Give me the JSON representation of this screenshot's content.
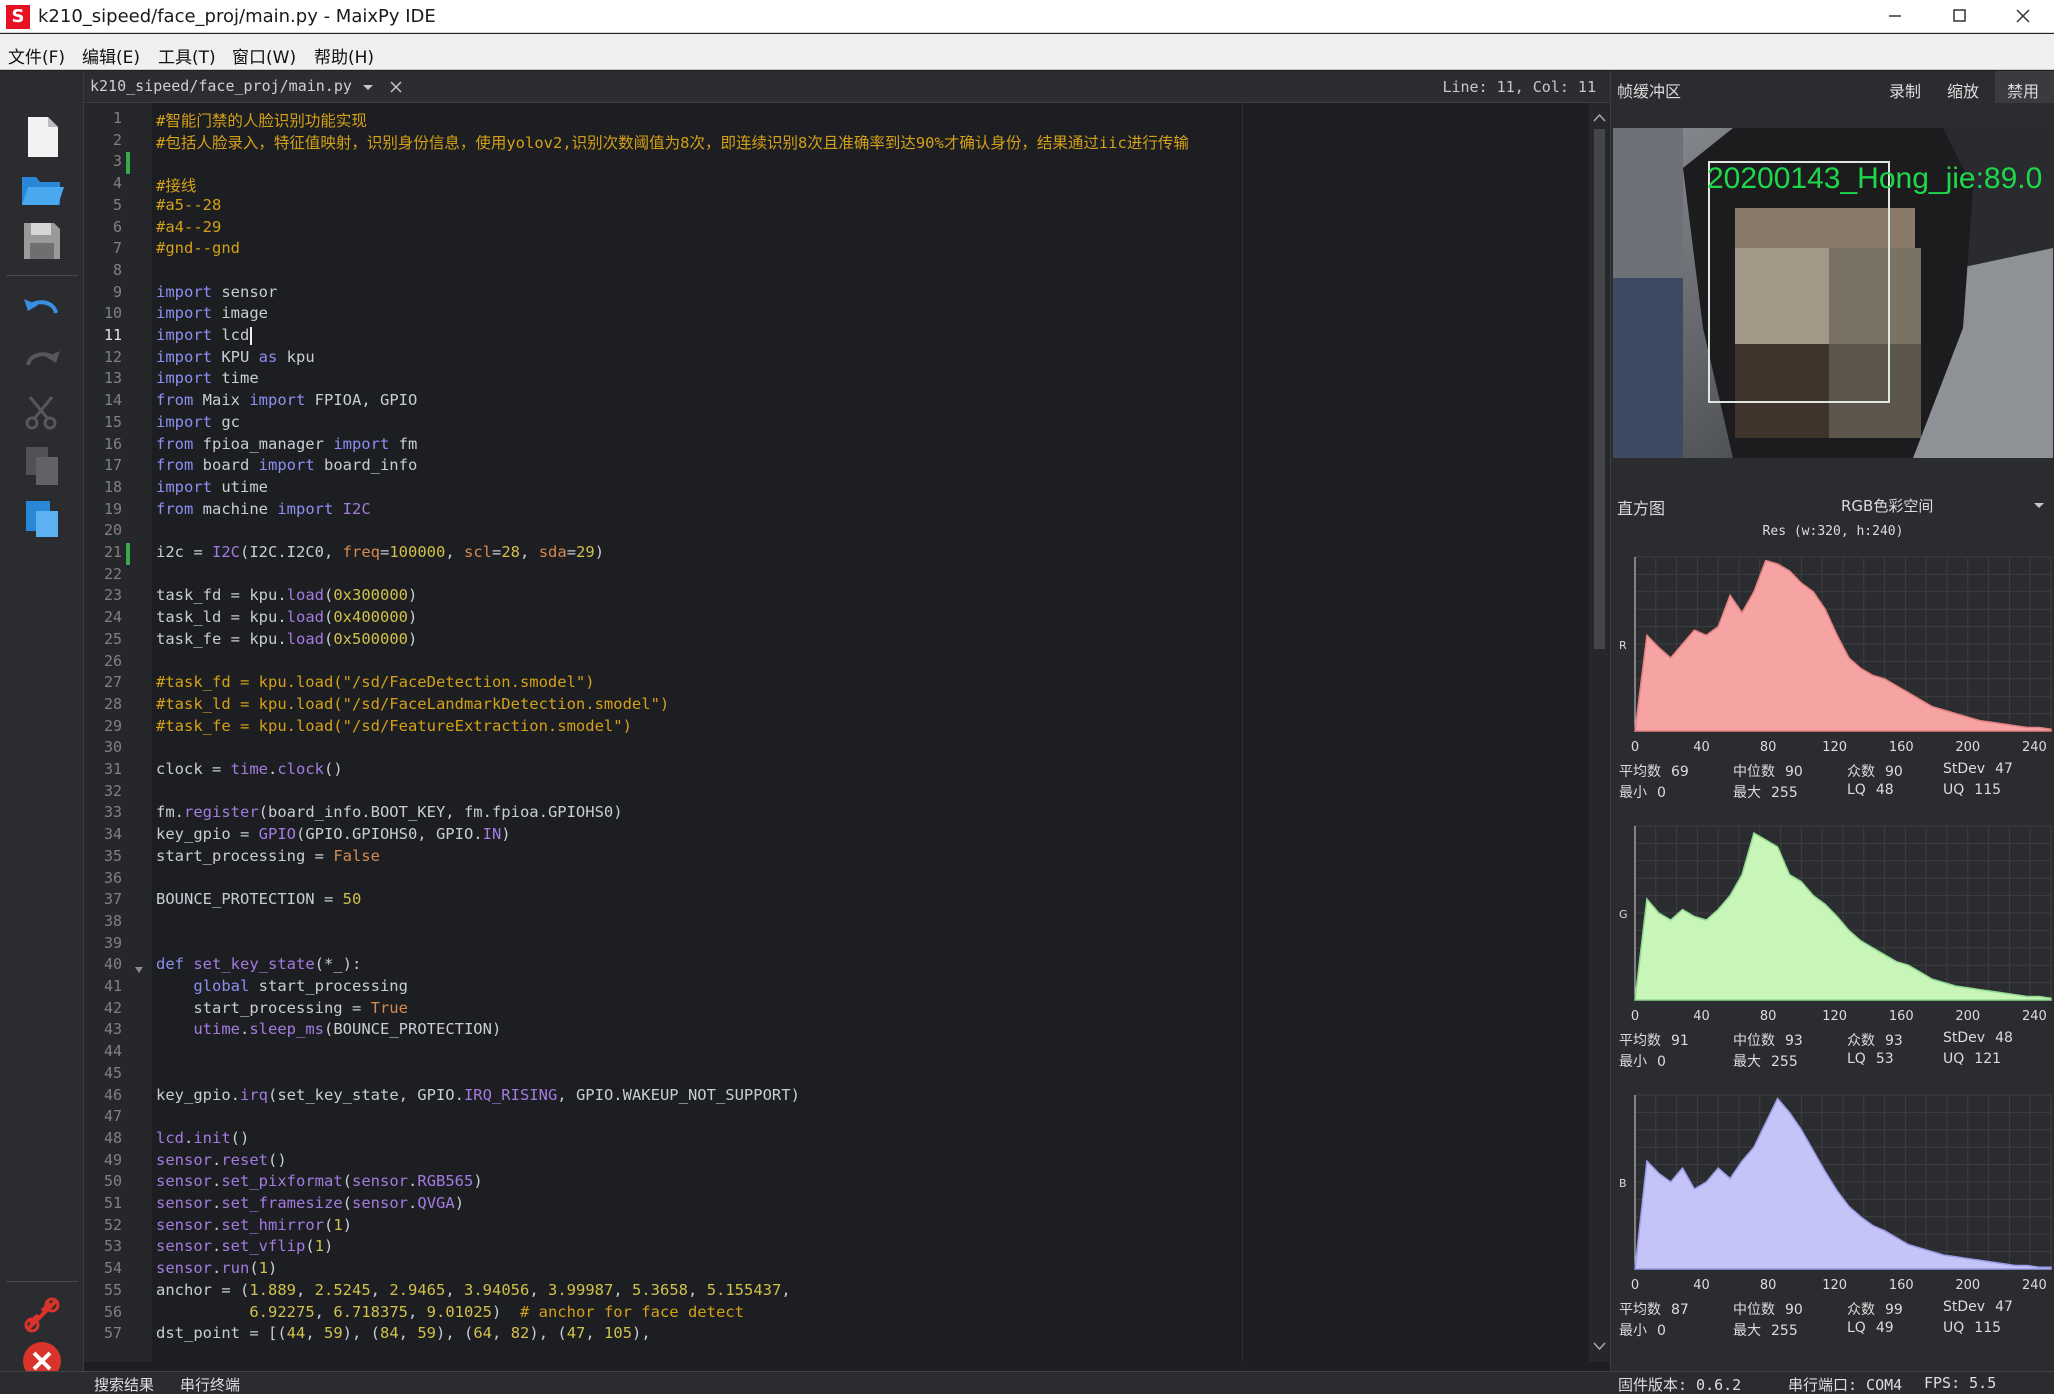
{
  "window": {
    "title": "k210_sipeed/face_proj/main.py - MaixPy IDE",
    "app_icon": "S"
  },
  "menu": [
    "文件(F)",
    "编辑(E)",
    "工具(T)",
    "窗口(W)",
    "帮助(H)"
  ],
  "toolbar_icons": [
    "new-file-icon",
    "open-folder-icon",
    "save-icon",
    "undo-icon",
    "redo-icon",
    "cut-icon",
    "copy-icon",
    "paste-icon",
    "connect-icon",
    "stop-icon"
  ],
  "editor": {
    "tab": "k210_sipeed/face_proj/main.py",
    "cursor_pos": "Line: 11, Col: 11",
    "current_line": 11,
    "lines": [
      [
        [
          "cm",
          "#智能门禁的人脸识别功能实现"
        ]
      ],
      [
        [
          "cm",
          "#包括人脸录入，特征值映射，识别身份信息，使用yolov2,识别次数阈值为8次，即连续识别8次且准确率到达90%才确认身份，结果通过iic进行传输"
        ]
      ],
      [],
      [
        [
          "cm",
          "#接线"
        ]
      ],
      [
        [
          "cm",
          "#a5--28"
        ]
      ],
      [
        [
          "cm",
          "#a4--29"
        ]
      ],
      [
        [
          "cm",
          "#gnd--gnd"
        ]
      ],
      [],
      [
        [
          "kw",
          "import"
        ],
        [
          "t",
          " sensor"
        ]
      ],
      [
        [
          "kw",
          "import"
        ],
        [
          "t",
          " image"
        ]
      ],
      [
        [
          "kw",
          "import"
        ],
        [
          "t",
          " lcd"
        ]
      ],
      [
        [
          "kw",
          "import"
        ],
        [
          "t",
          " KPU "
        ],
        [
          "kw",
          "as"
        ],
        [
          "t",
          " kpu"
        ]
      ],
      [
        [
          "kw",
          "import"
        ],
        [
          "t",
          " time"
        ]
      ],
      [
        [
          "kw",
          "from"
        ],
        [
          "t",
          " Maix "
        ],
        [
          "kw",
          "import"
        ],
        [
          "t",
          " FPIOA, GPIO"
        ]
      ],
      [
        [
          "kw",
          "import"
        ],
        [
          "t",
          " gc"
        ]
      ],
      [
        [
          "kw",
          "from"
        ],
        [
          "t",
          " fpioa_manager "
        ],
        [
          "kw",
          "import"
        ],
        [
          "t",
          " fm"
        ]
      ],
      [
        [
          "kw",
          "from"
        ],
        [
          "t",
          " board "
        ],
        [
          "kw",
          "import"
        ],
        [
          "t",
          " board_info"
        ]
      ],
      [
        [
          "kw",
          "import"
        ],
        [
          "t",
          " utime"
        ]
      ],
      [
        [
          "kw",
          "from"
        ],
        [
          "t",
          " machine "
        ],
        [
          "kw",
          "import"
        ],
        [
          "t",
          " "
        ],
        [
          "fn",
          "I2C"
        ]
      ],
      [],
      [
        [
          "t",
          "i2c = "
        ],
        [
          "fn",
          "I2C"
        ],
        [
          "t",
          "(I2C.I2C0, "
        ],
        [
          "kwarg",
          "freq"
        ],
        [
          "t",
          "="
        ],
        [
          "num",
          "100000"
        ],
        [
          "t",
          ", "
        ],
        [
          "kwarg",
          "scl"
        ],
        [
          "t",
          "="
        ],
        [
          "num",
          "28"
        ],
        [
          "t",
          ", "
        ],
        [
          "kwarg",
          "sda"
        ],
        [
          "t",
          "="
        ],
        [
          "num",
          "29"
        ],
        [
          "t",
          ")"
        ]
      ],
      [],
      [
        [
          "t",
          "task_fd = kpu."
        ],
        [
          "fn",
          "load"
        ],
        [
          "t",
          "("
        ],
        [
          "num",
          "0x300000"
        ],
        [
          "t",
          ")"
        ]
      ],
      [
        [
          "t",
          "task_ld = kpu."
        ],
        [
          "fn",
          "load"
        ],
        [
          "t",
          "("
        ],
        [
          "num",
          "0x400000"
        ],
        [
          "t",
          ")"
        ]
      ],
      [
        [
          "t",
          "task_fe = kpu."
        ],
        [
          "fn",
          "load"
        ],
        [
          "t",
          "("
        ],
        [
          "num",
          "0x500000"
        ],
        [
          "t",
          ")"
        ]
      ],
      [],
      [
        [
          "cm",
          "#task_fd = kpu.load(\"/sd/FaceDetection.smodel\")"
        ]
      ],
      [
        [
          "cm",
          "#task_ld = kpu.load(\"/sd/FaceLandmarkDetection.smodel\")"
        ]
      ],
      [
        [
          "cm",
          "#task_fe = kpu.load(\"/sd/FeatureExtraction.smodel\")"
        ]
      ],
      [],
      [
        [
          "t",
          "clock = "
        ],
        [
          "fn",
          "time"
        ],
        [
          "t",
          "."
        ],
        [
          "fn",
          "clock"
        ],
        [
          "t",
          "()"
        ]
      ],
      [],
      [
        [
          "t",
          "fm."
        ],
        [
          "fn",
          "register"
        ],
        [
          "t",
          "(board_info.BOOT_KEY, fm.fpioa.GPIOHS0)"
        ]
      ],
      [
        [
          "t",
          "key_gpio = "
        ],
        [
          "fn",
          "GPIO"
        ],
        [
          "t",
          "(GPIO.GPIOHS0, GPIO."
        ],
        [
          "fn",
          "IN"
        ],
        [
          "t",
          ")"
        ]
      ],
      [
        [
          "t",
          "start_processing = "
        ],
        [
          "cst",
          "False"
        ]
      ],
      [],
      [
        [
          "t",
          "BOUNCE_PROTECTION = "
        ],
        [
          "num",
          "50"
        ]
      ],
      [],
      [],
      [
        [
          "kw",
          "def"
        ],
        [
          "t",
          " "
        ],
        [
          "fn",
          "set_key_state"
        ],
        [
          "t",
          "(*_):"
        ]
      ],
      [
        [
          "t",
          "    "
        ],
        [
          "kw",
          "global"
        ],
        [
          "t",
          " start_processing"
        ]
      ],
      [
        [
          "t",
          "    start_processing = "
        ],
        [
          "cst",
          "True"
        ]
      ],
      [
        [
          "t",
          "    "
        ],
        [
          "fn",
          "utime"
        ],
        [
          "t",
          "."
        ],
        [
          "fn",
          "sleep_ms"
        ],
        [
          "t",
          "(BOUNCE_PROTECTION)"
        ]
      ],
      [],
      [],
      [
        [
          "t",
          "key_gpio."
        ],
        [
          "fn",
          "irq"
        ],
        [
          "t",
          "(set_key_state, GPIO."
        ],
        [
          "fn",
          "IRQ_RISING"
        ],
        [
          "t",
          ", GPIO.WAKEUP_NOT_SUPPORT)"
        ]
      ],
      [],
      [
        [
          "fn",
          "lcd"
        ],
        [
          "t",
          "."
        ],
        [
          "fn",
          "init"
        ],
        [
          "t",
          "()"
        ]
      ],
      [
        [
          "fn",
          "sensor"
        ],
        [
          "t",
          "."
        ],
        [
          "fn",
          "reset"
        ],
        [
          "t",
          "()"
        ]
      ],
      [
        [
          "fn",
          "sensor"
        ],
        [
          "t",
          "."
        ],
        [
          "fn",
          "set_pixformat"
        ],
        [
          "t",
          "("
        ],
        [
          "fn",
          "sensor"
        ],
        [
          "t",
          "."
        ],
        [
          "fn",
          "RGB565"
        ],
        [
          "t",
          ")"
        ]
      ],
      [
        [
          "fn",
          "sensor"
        ],
        [
          "t",
          "."
        ],
        [
          "fn",
          "set_framesize"
        ],
        [
          "t",
          "("
        ],
        [
          "fn",
          "sensor"
        ],
        [
          "t",
          "."
        ],
        [
          "fn",
          "QVGA"
        ],
        [
          "t",
          ")"
        ]
      ],
      [
        [
          "fn",
          "sensor"
        ],
        [
          "t",
          "."
        ],
        [
          "fn",
          "set_hmirror"
        ],
        [
          "t",
          "("
        ],
        [
          "num",
          "1"
        ],
        [
          "t",
          ")"
        ]
      ],
      [
        [
          "fn",
          "sensor"
        ],
        [
          "t",
          "."
        ],
        [
          "fn",
          "set_vflip"
        ],
        [
          "t",
          "("
        ],
        [
          "num",
          "1"
        ],
        [
          "t",
          ")"
        ]
      ],
      [
        [
          "fn",
          "sensor"
        ],
        [
          "t",
          "."
        ],
        [
          "fn",
          "run"
        ],
        [
          "t",
          "("
        ],
        [
          "num",
          "1"
        ],
        [
          "t",
          ")"
        ]
      ],
      [
        [
          "t",
          "anchor = ("
        ],
        [
          "num",
          "1.889"
        ],
        [
          "t",
          ", "
        ],
        [
          "num",
          "2.5245"
        ],
        [
          "t",
          ", "
        ],
        [
          "num",
          "2.9465"
        ],
        [
          "t",
          ", "
        ],
        [
          "num",
          "3.94056"
        ],
        [
          "t",
          ", "
        ],
        [
          "num",
          "3.99987"
        ],
        [
          "t",
          ", "
        ],
        [
          "num",
          "5.3658"
        ],
        [
          "t",
          ", "
        ],
        [
          "num",
          "5.155437"
        ],
        [
          "t",
          ","
        ]
      ],
      [
        [
          "t",
          "          "
        ],
        [
          "num",
          "6.92275"
        ],
        [
          "t",
          ", "
        ],
        [
          "num",
          "6.718375"
        ],
        [
          "t",
          ", "
        ],
        [
          "num",
          "9.01025"
        ],
        [
          "t",
          ")  "
        ],
        [
          "cm",
          "# anchor for face detect"
        ]
      ],
      [
        [
          "t",
          "dst_point = [("
        ],
        [
          "num",
          "44"
        ],
        [
          "t",
          ", "
        ],
        [
          "num",
          "59"
        ],
        [
          "t",
          "), ("
        ],
        [
          "num",
          "84"
        ],
        [
          "t",
          ", "
        ],
        [
          "num",
          "59"
        ],
        [
          "t",
          "), ("
        ],
        [
          "num",
          "64"
        ],
        [
          "t",
          ", "
        ],
        [
          "num",
          "82"
        ],
        [
          "t",
          "), ("
        ],
        [
          "num",
          "47"
        ],
        [
          "t",
          ", "
        ],
        [
          "num",
          "105"
        ],
        [
          "t",
          "),"
        ]
      ]
    ]
  },
  "frame_buffer": {
    "title": "帧缓冲区",
    "buttons": [
      "录制",
      "缩放",
      "禁用"
    ],
    "overlay_text": "20200143_Hong_jie:89.0"
  },
  "histogram": {
    "title": "直方图",
    "color_space": "RGB色彩空间",
    "resolution": "Res (w:320, h:240)",
    "x_ticks": [
      "0",
      "40",
      "80",
      "120",
      "160",
      "200",
      "240"
    ],
    "channels": [
      {
        "label": "R",
        "color": "#f5a3a3",
        "stroke": "#e68080",
        "values": [
          0,
          55,
          48,
          42,
          50,
          58,
          55,
          60,
          78,
          68,
          80,
          98,
          96,
          92,
          85,
          80,
          70,
          55,
          42,
          36,
          32,
          30,
          26,
          22,
          18,
          14,
          12,
          10,
          8,
          6,
          5,
          4,
          3,
          2,
          2,
          1
        ],
        "stats": {
          "mean": "69",
          "median": "90",
          "mode": "90",
          "stdev": "47",
          "min": "0",
          "max": "255",
          "lq": "48",
          "uq": "115"
        }
      },
      {
        "label": "G",
        "color": "#c8f5b8",
        "stroke": "#8fd88f",
        "values": [
          0,
          58,
          50,
          46,
          52,
          48,
          46,
          52,
          60,
          72,
          96,
          92,
          88,
          72,
          68,
          60,
          55,
          48,
          40,
          34,
          30,
          26,
          22,
          20,
          16,
          12,
          10,
          8,
          7,
          6,
          5,
          4,
          3,
          2,
          2,
          1
        ],
        "stats": {
          "mean": "91",
          "median": "93",
          "mode": "93",
          "stdev": "48",
          "min": "0",
          "max": "255",
          "lq": "53",
          "uq": "121"
        }
      },
      {
        "label": "B",
        "color": "#c4c4f8",
        "stroke": "#9a9ae8",
        "values": [
          0,
          62,
          55,
          50,
          58,
          46,
          50,
          58,
          52,
          62,
          70,
          84,
          98,
          90,
          80,
          68,
          56,
          45,
          36,
          30,
          25,
          22,
          18,
          14,
          12,
          10,
          8,
          7,
          6,
          5,
          4,
          3,
          2,
          2,
          1,
          1
        ],
        "stats": {
          "mean": "87",
          "median": "90",
          "mode": "99",
          "stdev": "47",
          "min": "0",
          "max": "255",
          "lq": "49",
          "uq": "115"
        }
      }
    ],
    "stat_labels": {
      "mean": "平均数",
      "median": "中位数",
      "mode": "众数",
      "stdev": "StDev",
      "min": "最小",
      "max": "最大",
      "lq": "LQ",
      "uq": "UQ"
    }
  },
  "status": {
    "left": [
      "搜索结果",
      "串行终端"
    ],
    "firmware": "固件版本: 0.6.2",
    "serial_port": "串行端口: COM4",
    "fps": "FPS:  5.5"
  }
}
